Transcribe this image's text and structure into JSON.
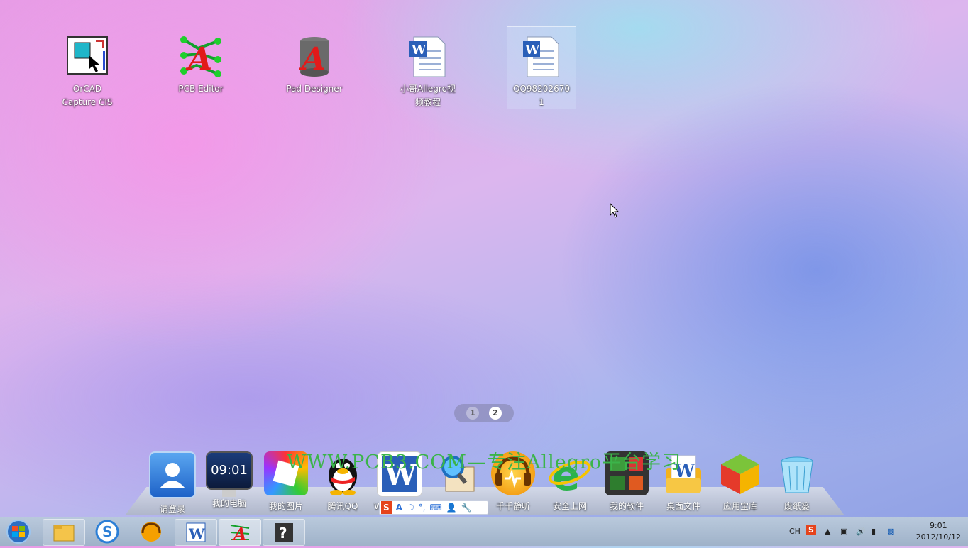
{
  "desktop_icons": [
    {
      "label": "OrCAD\nCapture CIS",
      "icon": "orcad-capture-icon"
    },
    {
      "label": "PCB Editor",
      "icon": "pcb-editor-icon"
    },
    {
      "label": "Pad Designer",
      "icon": "pad-designer-icon"
    },
    {
      "label": "小哥Allegro视\n频教程",
      "icon": "word-document-icon"
    },
    {
      "label": "QQ98202670\n1",
      "icon": "word-document-icon"
    }
  ],
  "pager": {
    "page1": "1",
    "page2": "2",
    "current": 2
  },
  "watermark": "WWW.PCB3.COM—专注Allegro平台学习",
  "dock": [
    {
      "label": "请登录",
      "icon": "login-icon"
    },
    {
      "label": "我的电脑",
      "icon": "computer-icon",
      "screen_text": "09:01"
    },
    {
      "label": "我的图片",
      "icon": "pictures-icon"
    },
    {
      "label": "腾讯QQ",
      "icon": "qq-penguin-icon"
    },
    {
      "label": "W",
      "icon": "word-icon"
    },
    {
      "label": "",
      "icon": "search-doc-icon"
    },
    {
      "label": "千千静听",
      "icon": "ttplayer-icon"
    },
    {
      "label": "安全上网",
      "icon": "ie-browser-icon"
    },
    {
      "label": "我的软件",
      "icon": "my-software-icon"
    },
    {
      "label": "桌面文件",
      "icon": "desktop-files-icon"
    },
    {
      "label": "应用宝库",
      "icon": "app-store-icon"
    },
    {
      "label": "废纸篓",
      "icon": "recycle-bin-icon"
    }
  ],
  "ime_bar": [
    "S",
    "A",
    "☽",
    "°,",
    "⌨",
    "👤",
    "🔧"
  ],
  "taskbar": {
    "buttons": [
      "file-explorer-icon",
      "sogou-browser-icon",
      "ttplayer-icon",
      "word-icon",
      "pcb-editor-icon",
      "help-icon"
    ],
    "tray": {
      "lang": "CH",
      "time": "9:01",
      "date": "2012/10/12"
    }
  }
}
